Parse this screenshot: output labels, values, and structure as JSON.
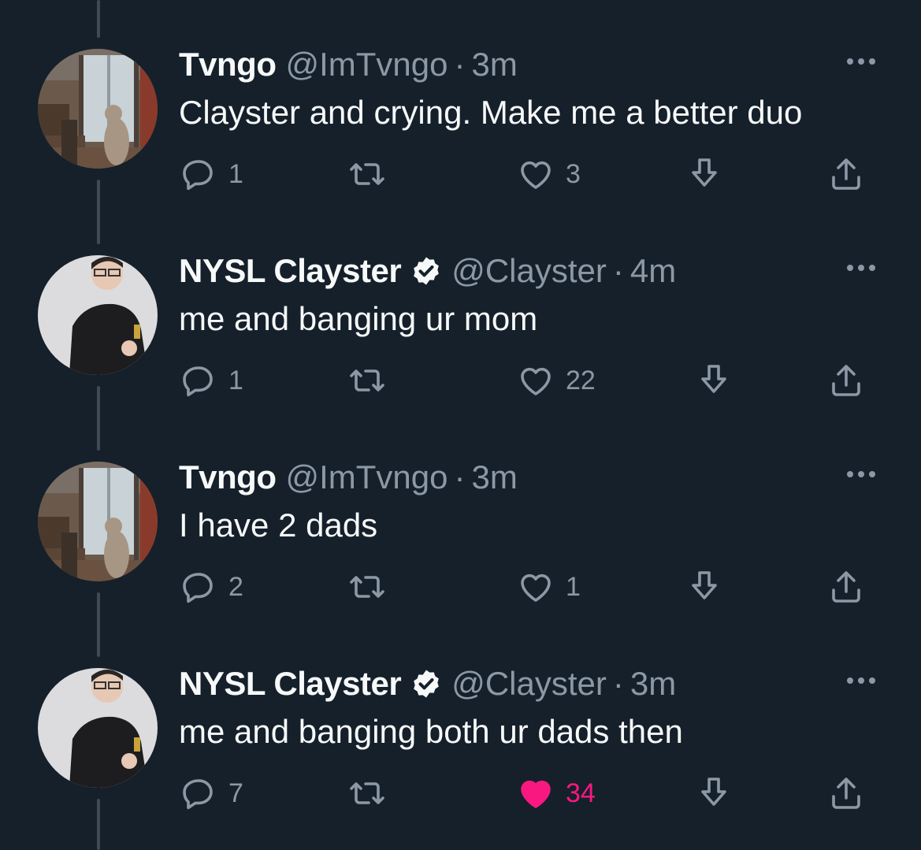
{
  "tweets": [
    {
      "name": "Tvngo",
      "handle": "@ImTvngo",
      "separator": "·",
      "time": "3m",
      "verified": false,
      "avatar": "dog-at-door",
      "text": "Clayster and crying. Make me a better duo",
      "reply_count": "1",
      "retweet_count": "",
      "like_count": "3",
      "liked": false
    },
    {
      "name": "NYSL Clayster",
      "handle": "@Clayster",
      "separator": "·",
      "time": "4m",
      "verified": true,
      "avatar": "person-with-glasses",
      "text": "me and banging ur mom",
      "reply_count": "1",
      "retweet_count": "",
      "like_count": "22",
      "liked": false
    },
    {
      "name": "Tvngo",
      "handle": "@ImTvngo",
      "separator": "·",
      "time": "3m",
      "verified": false,
      "avatar": "dog-at-door",
      "text": "I have 2 dads",
      "reply_count": "2",
      "retweet_count": "",
      "like_count": "1",
      "liked": false
    },
    {
      "name": "NYSL Clayster",
      "handle": "@Clayster",
      "separator": "·",
      "time": "3m",
      "verified": true,
      "avatar": "person-with-glasses",
      "text": "me and banging both ur dads then",
      "reply_count": "7",
      "retweet_count": "",
      "like_count": "34",
      "liked": true
    }
  ],
  "colors": {
    "background": "#15202b",
    "primary_text": "#f7f9f9",
    "secondary_text": "#8b98a5",
    "like_active": "#f91880",
    "thread_line": "#3d4a57"
  },
  "icons": {
    "reply": "reply-icon",
    "retweet": "retweet-icon",
    "like": "heart-icon",
    "download": "download-icon",
    "share": "share-icon",
    "more": "more-icon",
    "verified": "verified-badge-icon"
  }
}
